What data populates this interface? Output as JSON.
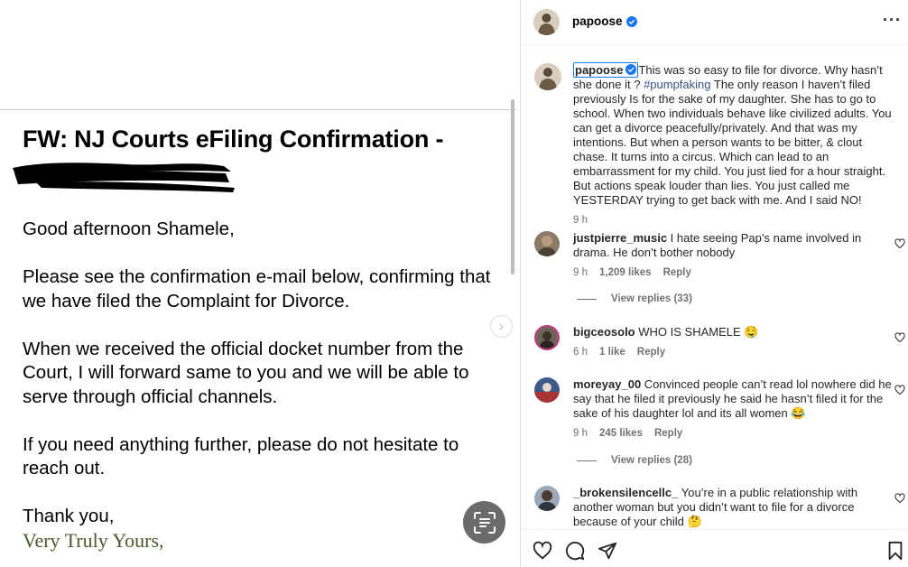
{
  "email": {
    "subject": "FW: NJ Courts eFiling Confirmation -",
    "greeting": "Good afternoon Shamele,",
    "paragraph1": "Please see the confirmation e-mail below, confirming that we have filed the Complaint for Divorce.",
    "paragraph2": "When we received the official docket number from the Court, I will forward same to you and we will be able to serve through official channels.",
    "paragraph3": "If you need anything further, please do not hesitate to reach out.",
    "closing": "Thank you,",
    "signoff": "Very Truly Yours,"
  },
  "post": {
    "author": "papoose",
    "caption": {
      "username": "papoose",
      "text_before": "This was so easy to file for divorce. Why hasn’t she done it ? ",
      "hashtag": "#pumpfaking",
      "text_after": " The only reason I haven’t filed previously Is for the sake of my daughter. She has to go to school. When two individuals behave like civilized adults. You can get a divorce peacefully/privately. And that was my intentions. But when a person wants to be bitter, & clout chase. It turns into a circus. Which can lead to an embarrassment for my child. You just lied for a hour straight. But actions speak louder than lies. You just called me YESTERDAY trying to get back with me. And I said NO!",
      "time": "9 h"
    },
    "comments": [
      {
        "username": "justpierre_music",
        "text": "I hate seeing Pap’s name involved in drama. He don’t bother nobody",
        "time": "9 h",
        "likes": "1,209 likes",
        "reply": "Reply",
        "view_replies": "View replies (33)"
      },
      {
        "username": "bigceosolo",
        "text": "WHO IS SHAMELE 🤤",
        "time": "6 h",
        "likes": "1 like",
        "reply": "Reply"
      },
      {
        "username": "moreyay_00",
        "text": "Convinced people can’t read lol nowhere did he say that he filed it previously he said he hasn’t filed it for the sake of his daughter lol and its all women 😂",
        "time": "9 h",
        "likes": "245 likes",
        "reply": "Reply",
        "view_replies": "View replies (28)"
      },
      {
        "username": "_brokensilencellc_",
        "text": "You’re in a public relationship with another woman but you didn’t want to file for a divorce because of your child 🤔"
      }
    ]
  },
  "icons": [
    "verified-badge-icon",
    "more-options-icon",
    "heart-icon",
    "comment-icon",
    "share-icon",
    "bookmark-icon",
    "chevron-right-icon",
    "text-scan-icon"
  ],
  "colors": {
    "link": "#385185",
    "verified": "#1877f2",
    "muted": "#737373",
    "signoff": "#4a5a2a"
  }
}
